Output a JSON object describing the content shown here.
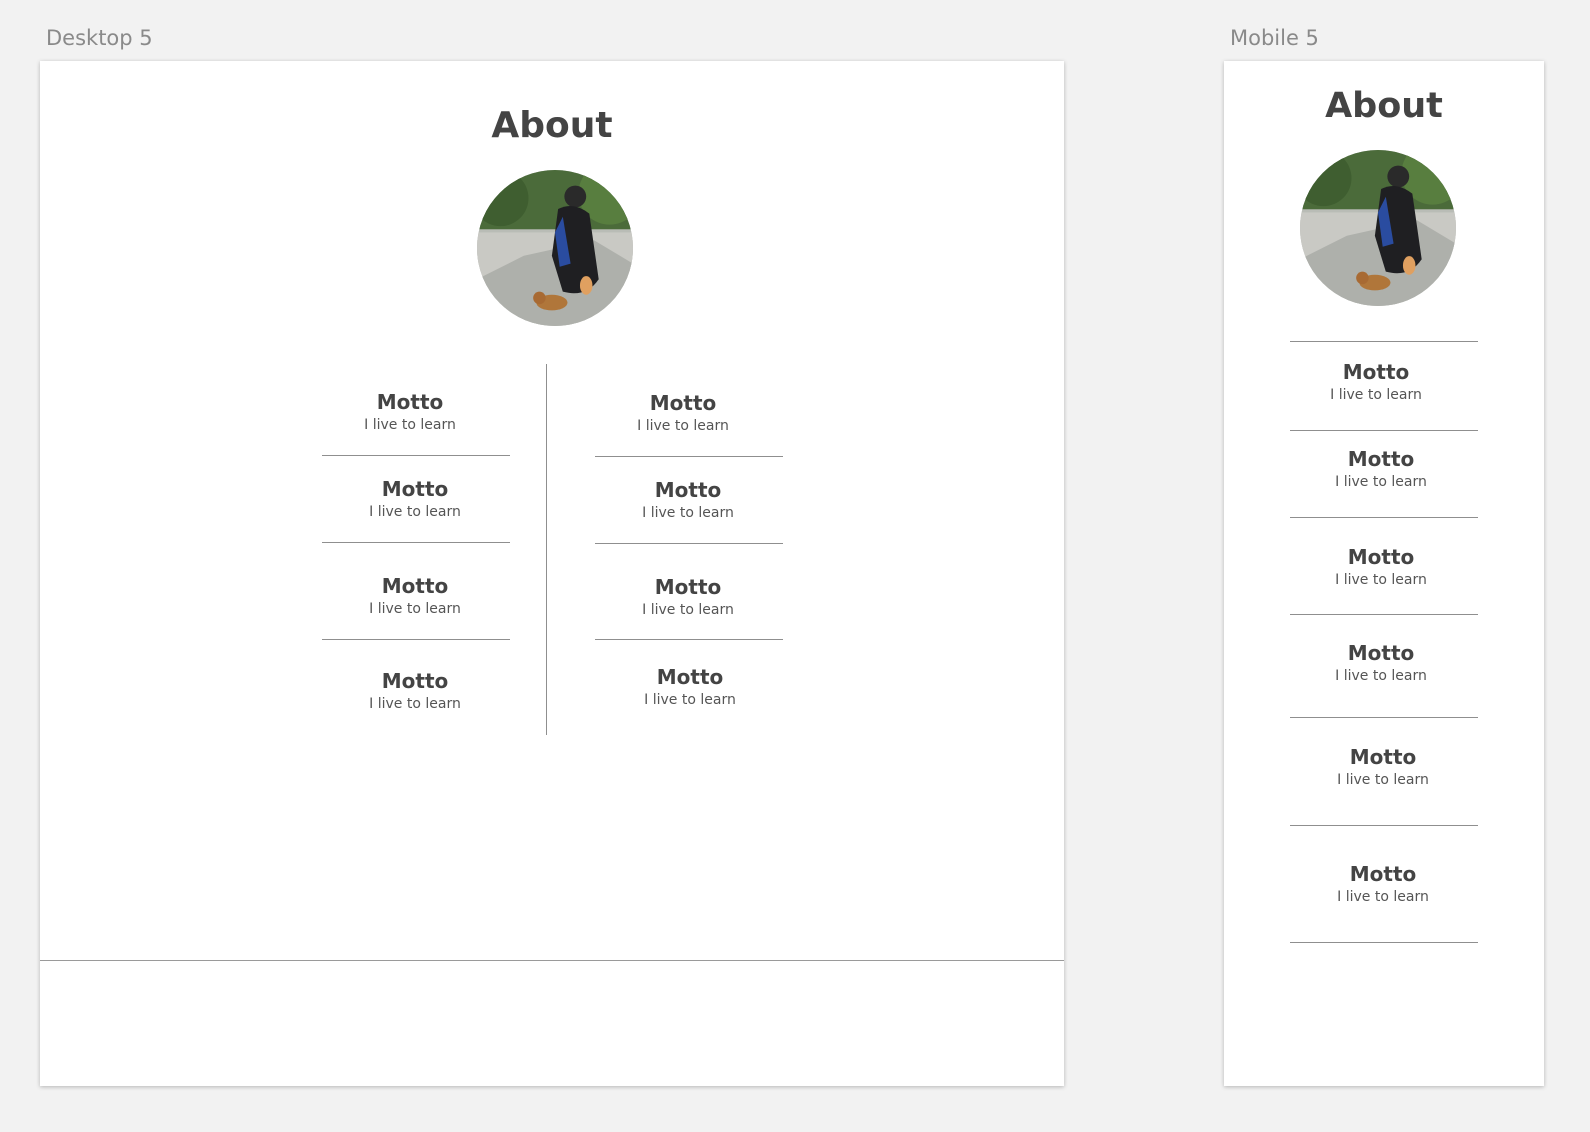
{
  "artboards": {
    "desktop": {
      "label": "Desktop 5"
    },
    "mobile": {
      "label": "Mobile 5"
    }
  },
  "about": {
    "title": "About",
    "avatar_alt": "graduate feeding a squirrel"
  },
  "motto": {
    "title": "Motto",
    "text": "I live to learn"
  }
}
